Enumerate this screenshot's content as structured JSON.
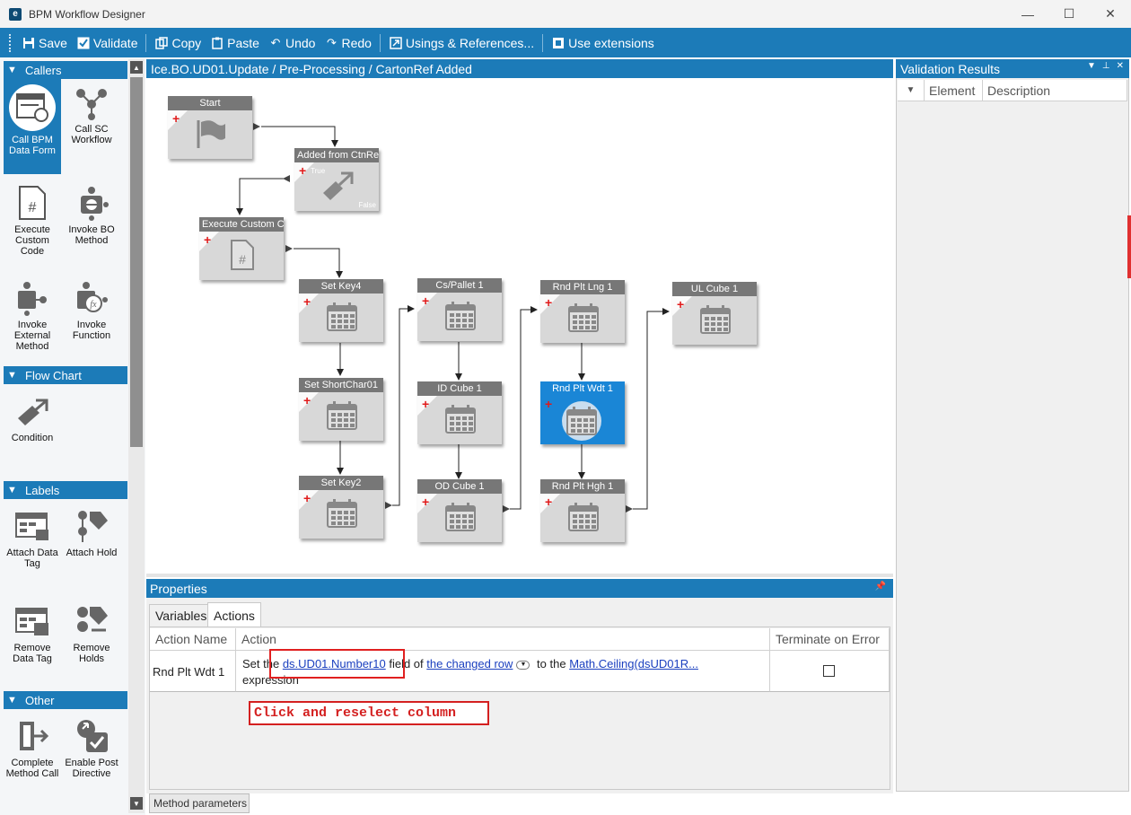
{
  "window": {
    "title": "BPM Workflow Designer",
    "controls": [
      "—",
      "☐",
      "✕"
    ]
  },
  "toolbar": {
    "save": "Save",
    "validate": "Validate",
    "copy": "Copy",
    "paste": "Paste",
    "undo": "Undo",
    "redo": "Redo",
    "usings": "Usings & References...",
    "use_extensions": "Use extensions"
  },
  "toolbox": {
    "groups": {
      "callers": "Callers",
      "flow_chart": "Flow Chart",
      "labels": "Labels",
      "other": "Other"
    },
    "tools": {
      "call_bpm_data_form": "Call BPM Data Form",
      "call_sc_workflow": "Call SC Workflow",
      "execute_custom_code": "Execute Custom Code",
      "invoke_bo_method": "Invoke BO Method",
      "invoke_external_method": "Invoke External Method",
      "invoke_function": "Invoke Function",
      "condition": "Condition",
      "attach_data_tag": "Attach Data Tag",
      "attach_hold": "Attach Hold",
      "remove_data_tag": "Remove Data Tag",
      "remove_holds": "Remove Holds",
      "complete_method_call": "Complete Method Call",
      "enable_post_directive": "Enable Post Directive"
    }
  },
  "designer": {
    "path": "Ice.BO.UD01.Update / Pre-Processing / CartonRef Added",
    "nodes": {
      "start": "Start",
      "added": "Added from CtnRef",
      "added_true": "True",
      "added_false": "False",
      "exec": "Execute Custom Code",
      "setkey4": "Set Key4",
      "shortchar": "Set ShortChar01",
      "setkey2": "Set Key2",
      "cspallet": "Cs/Pallet 1",
      "idcube": "ID Cube 1",
      "odcube": "OD Cube 1",
      "rndlng": "Rnd Plt Lng 1",
      "rndwdt": "Rnd Plt Wdt 1",
      "rndhgh": "Rnd Plt Hgh 1",
      "ulcube": "UL Cube 1"
    }
  },
  "properties": {
    "title": "Properties",
    "tabs": {
      "variables": "Variables",
      "actions": "Actions"
    },
    "columns": {
      "action_name": "Action Name",
      "action": "Action",
      "terminate": "Terminate on Error"
    },
    "row": {
      "name": "Rnd Plt Wdt 1",
      "set_the": "Set the",
      "field_link": "ds.UD01.Number10",
      "field_of": "field of",
      "row_link": "the changed row",
      "to_the": "to the",
      "expr_link": "Math.Ceiling(dsUD01R...",
      "expression": "expression",
      "terminate_checked": false
    },
    "annotation": "Click and reselect column",
    "method_tab": "Method parameters"
  },
  "validation": {
    "title": "Validation Results",
    "columns": {
      "element": "Element",
      "description": "Description"
    }
  },
  "colors": {
    "accent": "#1c7bb8",
    "node": "#d8d8d8",
    "node_header": "#777777",
    "selected_node": "#1a86d6",
    "annotation": "#d42020"
  }
}
